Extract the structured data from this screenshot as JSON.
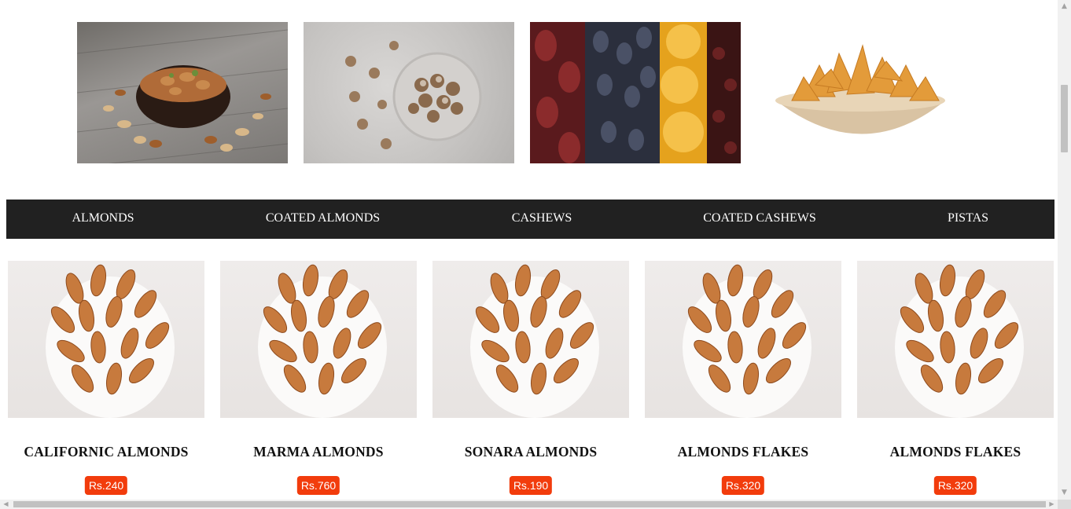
{
  "category_images": [
    {
      "icon": "mixed-nuts-bowl-photo"
    },
    {
      "icon": "coated-nuts-glass-bowl-photo"
    },
    {
      "icon": "dried-fruits-photo"
    },
    {
      "icon": "savory-snacks-bowl-photo"
    }
  ],
  "nav": {
    "tabs": [
      {
        "label": "ALMONDS"
      },
      {
        "label": "COATED ALMONDS"
      },
      {
        "label": "CASHEWS"
      },
      {
        "label": "COATED CASHEWS"
      },
      {
        "label": "PISTAS"
      }
    ]
  },
  "products": [
    {
      "name": "CALIFORNIC ALMONDS",
      "price": "Rs.240"
    },
    {
      "name": "MARMA ALMONDS",
      "price": "Rs.760"
    },
    {
      "name": "SONARA ALMONDS",
      "price": "Rs.190"
    },
    {
      "name": "ALMONDS FLAKES",
      "price": "Rs.320"
    },
    {
      "name": "ALMONDS FLAKES",
      "price": "Rs.320"
    }
  ],
  "colors": {
    "nav_bg": "#212121",
    "price_badge": "#f23c0c"
  },
  "scrollbar": {
    "up_arrow": "▲",
    "down_arrow": "▼",
    "left_arrow": "◀",
    "right_arrow": "▶"
  }
}
